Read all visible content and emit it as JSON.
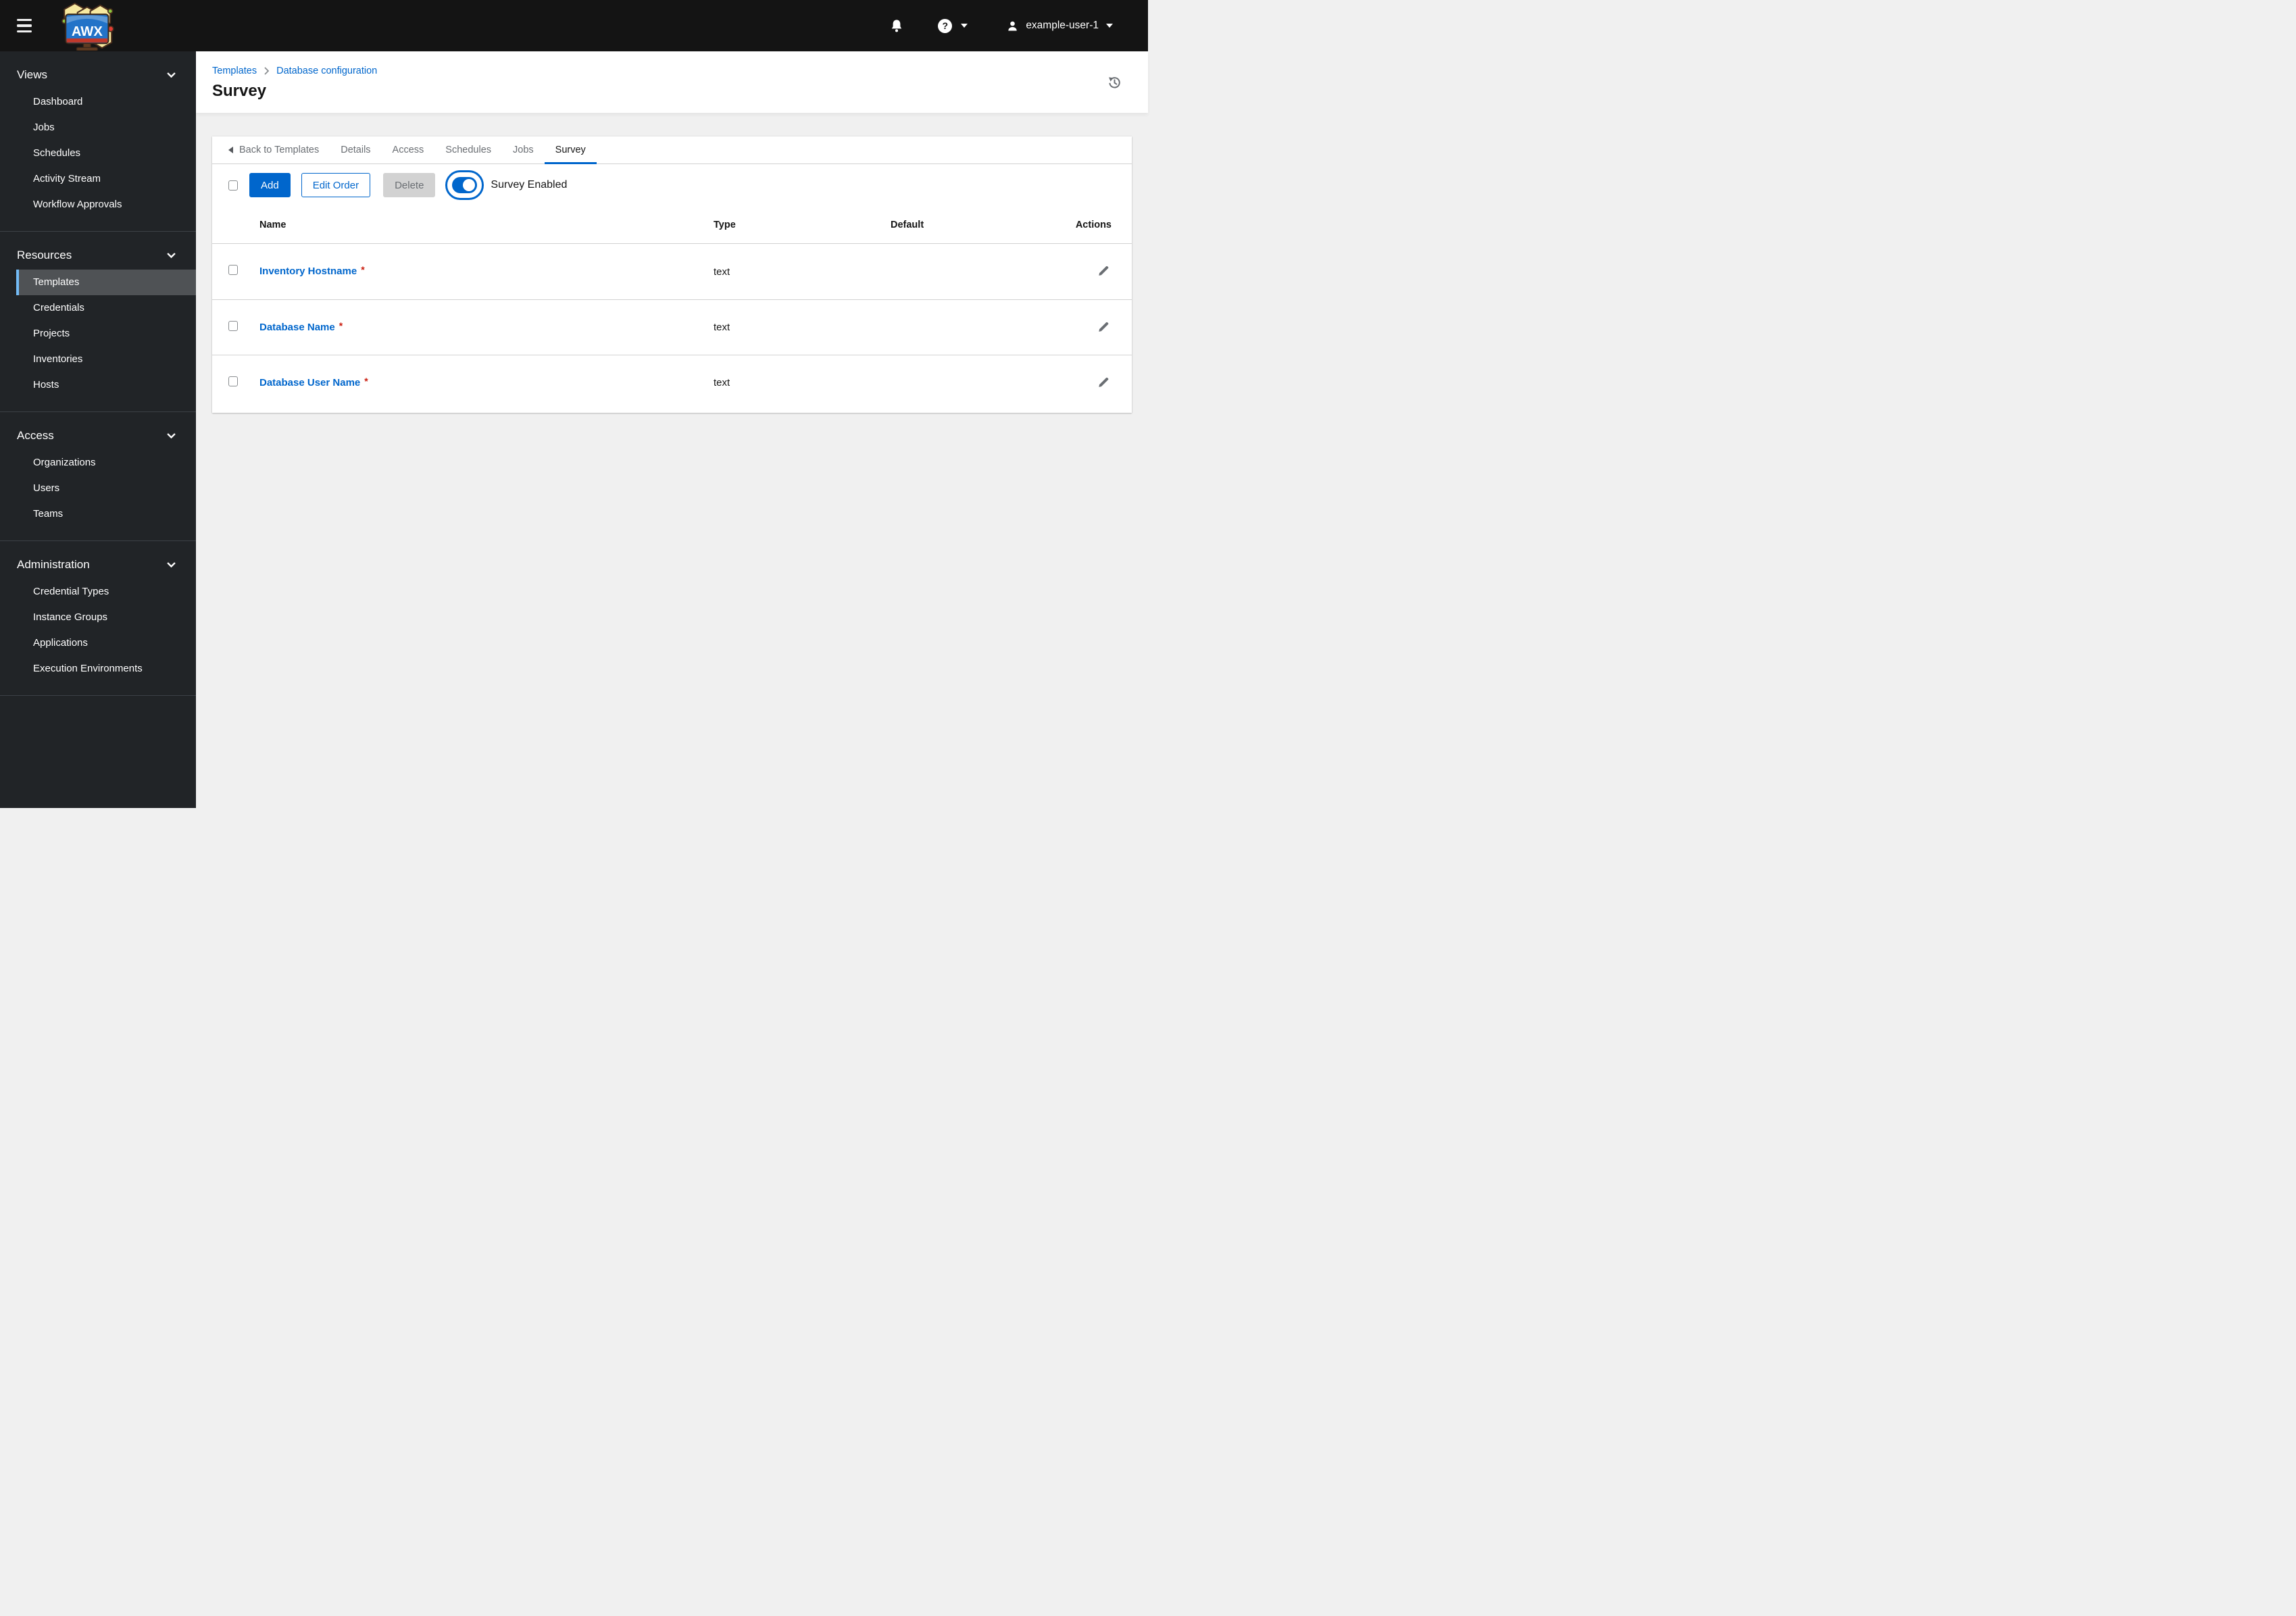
{
  "topbar": {
    "brand": "AWX",
    "user_name": "example-user-1"
  },
  "sidebar": {
    "groups": [
      {
        "label": "Views",
        "items": [
          {
            "label": "Dashboard"
          },
          {
            "label": "Jobs"
          },
          {
            "label": "Schedules"
          },
          {
            "label": "Activity Stream"
          },
          {
            "label": "Workflow Approvals"
          }
        ]
      },
      {
        "label": "Resources",
        "items": [
          {
            "label": "Templates",
            "current": true
          },
          {
            "label": "Credentials"
          },
          {
            "label": "Projects"
          },
          {
            "label": "Inventories"
          },
          {
            "label": "Hosts"
          }
        ]
      },
      {
        "label": "Access",
        "items": [
          {
            "label": "Organizations"
          },
          {
            "label": "Users"
          },
          {
            "label": "Teams"
          }
        ]
      },
      {
        "label": "Administration",
        "items": [
          {
            "label": "Credential Types"
          },
          {
            "label": "Instance Groups"
          },
          {
            "label": "Applications"
          },
          {
            "label": "Execution Environments"
          }
        ]
      }
    ]
  },
  "breadcrumb": {
    "items": [
      "Templates",
      "Database configuration"
    ]
  },
  "page": {
    "title": "Survey"
  },
  "tabs": {
    "back_label": "Back to Templates",
    "items": [
      "Details",
      "Access",
      "Schedules",
      "Jobs",
      "Survey"
    ],
    "active": "Survey"
  },
  "toolbar": {
    "add_label": "Add",
    "edit_order_label": "Edit Order",
    "delete_label": "Delete",
    "survey_toggle_label": "Survey Enabled",
    "survey_enabled": true
  },
  "table": {
    "headers": [
      "Name",
      "Type",
      "Default",
      "Actions"
    ],
    "required_marker": "*",
    "rows": [
      {
        "name": "Inventory Hostname",
        "type": "text",
        "default": "",
        "required": true
      },
      {
        "name": "Database Name",
        "type": "text",
        "default": "",
        "required": true
      },
      {
        "name": "Database User Name",
        "type": "text",
        "default": "",
        "required": true
      }
    ]
  },
  "colors": {
    "accent_blue": "#0066cc",
    "link_blue": "#0066cc",
    "nav_current_bg": "#4f5255",
    "nav_current_bar": "#73bcf7",
    "danger_red": "#c9190b",
    "topbar_bg": "#141414",
    "sidebar_bg": "#212427",
    "content_bg": "#f0f0f0",
    "disabled_bg": "#d2d2d2",
    "muted_text": "#6a6e73",
    "border_gray": "#d2d2d2"
  }
}
